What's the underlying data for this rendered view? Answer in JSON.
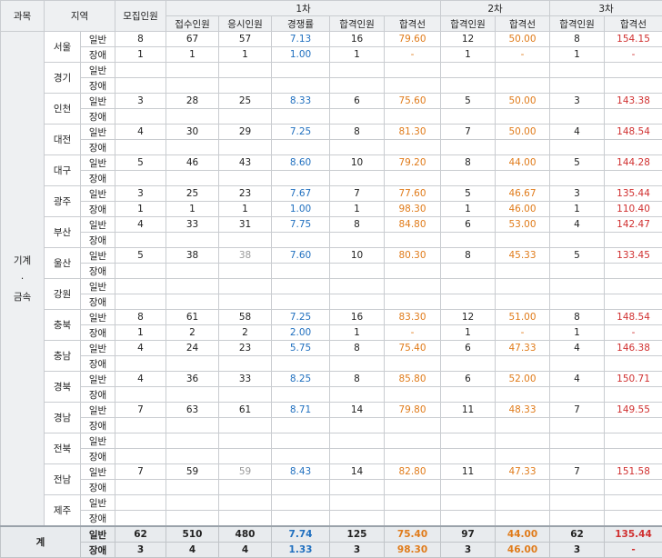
{
  "headers": {
    "subject": "과목",
    "region": "지역",
    "recruit": "모집인원",
    "round1": "1차",
    "round2": "2차",
    "round3": "3차",
    "applied": "접수인원",
    "attended": "응시인원",
    "ratio": "경쟁률",
    "passers": "합격인원",
    "cutoff": "합격선"
  },
  "subject_name": {
    "line1": "기계",
    "dot": "·",
    "line2": "금속"
  },
  "types": {
    "general": "일반",
    "disabled": "장애"
  },
  "regions": [
    {
      "name": "서울",
      "rows": [
        [
          "8",
          "67",
          "57",
          "7.13",
          "16",
          "79.60",
          "12",
          "50.00",
          "8",
          "154.15"
        ],
        [
          "1",
          "1",
          "1",
          "1.00",
          "1",
          "-",
          "1",
          "-",
          "1",
          "-"
        ]
      ]
    },
    {
      "name": "경기",
      "rows": [
        [
          "",
          "",
          "",
          "",
          "",
          "",
          "",
          "",
          "",
          ""
        ],
        [
          "",
          "",
          "",
          "",
          "",
          "",
          "",
          "",
          "",
          ""
        ]
      ]
    },
    {
      "name": "인천",
      "rows": [
        [
          "3",
          "28",
          "25",
          "8.33",
          "6",
          "75.60",
          "5",
          "50.00",
          "3",
          "143.38"
        ],
        [
          "",
          "",
          "",
          "",
          "",
          "",
          "",
          "",
          "",
          ""
        ]
      ]
    },
    {
      "name": "대전",
      "rows": [
        [
          "4",
          "30",
          "29",
          "7.25",
          "8",
          "81.30",
          "7",
          "50.00",
          "4",
          "148.54"
        ],
        [
          "",
          "",
          "",
          "",
          "",
          "",
          "",
          "",
          "",
          ""
        ]
      ]
    },
    {
      "name": "대구",
      "rows": [
        [
          "5",
          "46",
          "43",
          "8.60",
          "10",
          "79.20",
          "8",
          "44.00",
          "5",
          "144.28"
        ],
        [
          "",
          "",
          "",
          "",
          "",
          "",
          "",
          "",
          "",
          ""
        ]
      ]
    },
    {
      "name": "광주",
      "rows": [
        [
          "3",
          "25",
          "23",
          "7.67",
          "7",
          "77.60",
          "5",
          "46.67",
          "3",
          "135.44"
        ],
        [
          "1",
          "1",
          "1",
          "1.00",
          "1",
          "98.30",
          "1",
          "46.00",
          "1",
          "110.40"
        ]
      ]
    },
    {
      "name": "부산",
      "rows": [
        [
          "4",
          "33",
          "31",
          "7.75",
          "8",
          "84.80",
          "6",
          "53.00",
          "4",
          "142.47"
        ],
        [
          "",
          "",
          "",
          "",
          "",
          "",
          "",
          "",
          "",
          ""
        ]
      ]
    },
    {
      "name": "울산",
      "rows": [
        [
          "5",
          "38",
          "38",
          "7.60",
          "10",
          "80.30",
          "8",
          "45.33",
          "5",
          "133.45"
        ],
        [
          "",
          "",
          "",
          "",
          "",
          "",
          "",
          "",
          "",
          ""
        ]
      ]
    },
    {
      "name": "강원",
      "rows": [
        [
          "",
          "",
          "",
          "",
          "",
          "",
          "",
          "",
          "",
          ""
        ],
        [
          "",
          "",
          "",
          "",
          "",
          "",
          "",
          "",
          "",
          ""
        ]
      ]
    },
    {
      "name": "충북",
      "rows": [
        [
          "8",
          "61",
          "58",
          "7.25",
          "16",
          "83.30",
          "12",
          "51.00",
          "8",
          "148.54"
        ],
        [
          "1",
          "2",
          "2",
          "2.00",
          "1",
          "-",
          "1",
          "-",
          "1",
          "-"
        ]
      ]
    },
    {
      "name": "충남",
      "rows": [
        [
          "4",
          "24",
          "23",
          "5.75",
          "8",
          "75.40",
          "6",
          "47.33",
          "4",
          "146.38"
        ],
        [
          "",
          "",
          "",
          "",
          "",
          "",
          "",
          "",
          "",
          ""
        ]
      ]
    },
    {
      "name": "경북",
      "rows": [
        [
          "4",
          "36",
          "33",
          "8.25",
          "8",
          "85.80",
          "6",
          "52.00",
          "4",
          "150.71"
        ],
        [
          "",
          "",
          "",
          "",
          "",
          "",
          "",
          "",
          "",
          ""
        ]
      ]
    },
    {
      "name": "경남",
      "rows": [
        [
          "7",
          "63",
          "61",
          "8.71",
          "14",
          "79.80",
          "11",
          "48.33",
          "7",
          "149.55"
        ],
        [
          "",
          "",
          "",
          "",
          "",
          "",
          "",
          "",
          "",
          ""
        ]
      ]
    },
    {
      "name": "전북",
      "rows": [
        [
          "",
          "",
          "",
          "",
          "",
          "",
          "",
          "",
          "",
          ""
        ],
        [
          "",
          "",
          "",
          "",
          "",
          "",
          "",
          "",
          "",
          ""
        ]
      ]
    },
    {
      "name": "전남",
      "rows": [
        [
          "7",
          "59",
          "59",
          "8.43",
          "14",
          "82.80",
          "11",
          "47.33",
          "7",
          "151.58"
        ],
        [
          "",
          "",
          "",
          "",
          "",
          "",
          "",
          "",
          "",
          ""
        ]
      ]
    },
    {
      "name": "제주",
      "rows": [
        [
          "",
          "",
          "",
          "",
          "",
          "",
          "",
          "",
          "",
          ""
        ],
        [
          "",
          "",
          "",
          "",
          "",
          "",
          "",
          "",
          "",
          ""
        ]
      ]
    }
  ],
  "total": {
    "label": "계",
    "rows": [
      [
        "62",
        "510",
        "480",
        "7.74",
        "125",
        "75.40",
        "97",
        "44.00",
        "62",
        "135.44"
      ],
      [
        "3",
        "4",
        "4",
        "1.33",
        "3",
        "98.30",
        "3",
        "46.00",
        "3",
        "-"
      ]
    ]
  },
  "colors": {
    "ratio": "#1f6fbf",
    "cutoff_round1": "#e07b1a",
    "cutoff_round2": "#e07b1a",
    "cutoff_round3": "#d03030"
  }
}
